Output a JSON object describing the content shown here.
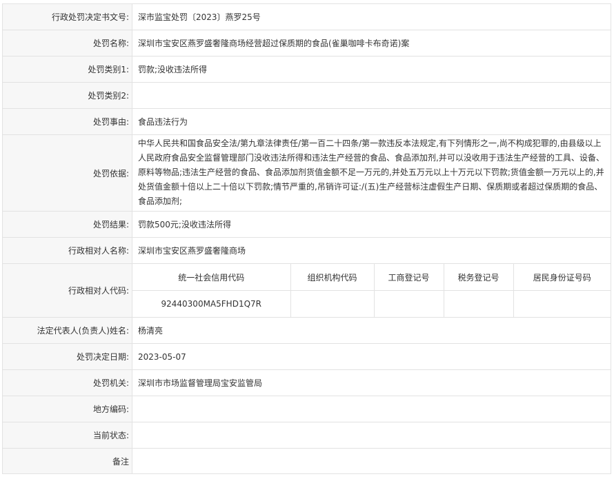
{
  "rows": {
    "doc_no": {
      "label": "行政处罚决定书文号:",
      "value": "深市监宝处罚〔2023〕燕罗25号"
    },
    "name": {
      "label": "处罚名称:",
      "value": "深圳市宝安区燕罗盛奢隆商场经营超过保质期的食品(雀巢咖啡卡布奇诺)案"
    },
    "category1": {
      "label": "处罚类别1:",
      "value": "罚款;没收违法所得"
    },
    "category2": {
      "label": "处罚类别2:",
      "value": ""
    },
    "reason": {
      "label": "处罚事由:",
      "value": "食品违法行为"
    },
    "basis": {
      "label": "处罚依据:",
      "value": "中华人民共和国食品安全法/第九章法律责任/第一百二十四条/第一款违反本法规定,有下列情形之一,尚不构成犯罪的,由县级以上人民政府食品安全监督管理部门没收违法所得和违法生产经营的食品、食品添加剂,并可以没收用于违法生产经营的工具、设备、原料等物品;违法生产经营的食品、食品添加剂货值金额不足一万元的,并处五万元以上十万元以下罚款;货值金额一万元以上的,并处货值金额十倍以上二十倍以下罚款;情节严重的,吊销许可证:/(五)生产经营标注虚假生产日期、保质期或者超过保质期的食品、食品添加剂;"
    },
    "result": {
      "label": "处罚结果:",
      "value": "罚款500元;没收违法所得"
    },
    "party_name": {
      "label": "行政相对人名称:",
      "value": "深圳市宝安区燕罗盛奢隆商场"
    },
    "party_code": {
      "label": "行政相对人代码:",
      "headers": [
        "统一社会信用代码",
        "组织机构代码",
        "工商登记号",
        "税务登记号",
        "居民身份证号码"
      ],
      "values": [
        "92440300MA5FHD1Q7R",
        "",
        "",
        "",
        ""
      ]
    },
    "legal_rep": {
      "label": "法定代表人(负责人)姓名:",
      "value": "杨清亮"
    },
    "decision_date": {
      "label": "处罚决定日期:",
      "value": "2023-05-07"
    },
    "authority": {
      "label": "处罚机关:",
      "value": "深圳市市场监督管理局宝安监管局"
    },
    "local_code": {
      "label": "地方编码:",
      "value": ""
    },
    "status": {
      "label": "当前状态:",
      "value": ""
    },
    "remark": {
      "label": "备注",
      "value": ""
    }
  }
}
